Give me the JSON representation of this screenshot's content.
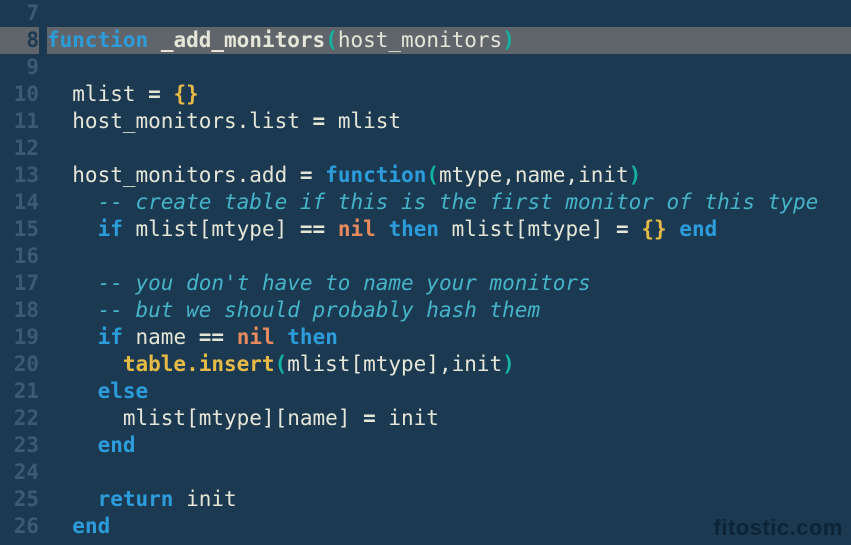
{
  "watermark": "fitostic.com",
  "highlighted_line_index": 1,
  "lines": [
    {
      "num": "7",
      "tokens": []
    },
    {
      "num": "8",
      "tokens": [
        {
          "cls": "tok-kw",
          "t": "function"
        },
        {
          "cls": "tok-id",
          "t": " "
        },
        {
          "cls": "tok-fn",
          "t": "_add_monitors"
        },
        {
          "cls": "tok-par",
          "t": "("
        },
        {
          "cls": "tok-id",
          "t": "host_monitors"
        },
        {
          "cls": "tok-par",
          "t": ")"
        }
      ]
    },
    {
      "num": "9",
      "tokens": []
    },
    {
      "num": "10",
      "tokens": [
        {
          "cls": "tok-id",
          "t": "  mlist "
        },
        {
          "cls": "tok-pun",
          "t": "="
        },
        {
          "cls": "tok-id",
          "t": " "
        },
        {
          "cls": "tok-brc",
          "t": "{}"
        }
      ]
    },
    {
      "num": "11",
      "tokens": [
        {
          "cls": "tok-id",
          "t": "  host_monitors.list "
        },
        {
          "cls": "tok-pun",
          "t": "="
        },
        {
          "cls": "tok-id",
          "t": " mlist"
        }
      ]
    },
    {
      "num": "12",
      "tokens": []
    },
    {
      "num": "13",
      "tokens": [
        {
          "cls": "tok-id",
          "t": "  host_monitors.add "
        },
        {
          "cls": "tok-pun",
          "t": "="
        },
        {
          "cls": "tok-id",
          "t": " "
        },
        {
          "cls": "tok-kw",
          "t": "function"
        },
        {
          "cls": "tok-par",
          "t": "("
        },
        {
          "cls": "tok-id",
          "t": "mtype,name,init"
        },
        {
          "cls": "tok-par",
          "t": ")"
        }
      ]
    },
    {
      "num": "14",
      "tokens": [
        {
          "cls": "tok-id",
          "t": "    "
        },
        {
          "cls": "tok-cmt",
          "t": "-- create table if this is the first monitor of this type"
        }
      ]
    },
    {
      "num": "15",
      "tokens": [
        {
          "cls": "tok-id",
          "t": "    "
        },
        {
          "cls": "tok-kw",
          "t": "if"
        },
        {
          "cls": "tok-id",
          "t": " mlist[mtype] "
        },
        {
          "cls": "tok-pun",
          "t": "=="
        },
        {
          "cls": "tok-id",
          "t": " "
        },
        {
          "cls": "tok-lit",
          "t": "nil"
        },
        {
          "cls": "tok-id",
          "t": " "
        },
        {
          "cls": "tok-kw",
          "t": "then"
        },
        {
          "cls": "tok-id",
          "t": " mlist[mtype] "
        },
        {
          "cls": "tok-pun",
          "t": "="
        },
        {
          "cls": "tok-id",
          "t": " "
        },
        {
          "cls": "tok-brc",
          "t": "{}"
        },
        {
          "cls": "tok-id",
          "t": " "
        },
        {
          "cls": "tok-kw",
          "t": "end"
        }
      ]
    },
    {
      "num": "16",
      "tokens": []
    },
    {
      "num": "17",
      "tokens": [
        {
          "cls": "tok-id",
          "t": "    "
        },
        {
          "cls": "tok-cmt",
          "t": "-- you don't have to name your monitors"
        }
      ]
    },
    {
      "num": "18",
      "tokens": [
        {
          "cls": "tok-id",
          "t": "    "
        },
        {
          "cls": "tok-cmt",
          "t": "-- but we should probably hash them"
        }
      ]
    },
    {
      "num": "19",
      "tokens": [
        {
          "cls": "tok-id",
          "t": "    "
        },
        {
          "cls": "tok-kw",
          "t": "if"
        },
        {
          "cls": "tok-id",
          "t": " name "
        },
        {
          "cls": "tok-pun",
          "t": "=="
        },
        {
          "cls": "tok-id",
          "t": " "
        },
        {
          "cls": "tok-lit",
          "t": "nil"
        },
        {
          "cls": "tok-id",
          "t": " "
        },
        {
          "cls": "tok-kw",
          "t": "then"
        }
      ]
    },
    {
      "num": "20",
      "tokens": [
        {
          "cls": "tok-id",
          "t": "      "
        },
        {
          "cls": "tok-lib",
          "t": "table.insert"
        },
        {
          "cls": "tok-par",
          "t": "("
        },
        {
          "cls": "tok-id",
          "t": "mlist[mtype],init"
        },
        {
          "cls": "tok-par",
          "t": ")"
        }
      ]
    },
    {
      "num": "21",
      "tokens": [
        {
          "cls": "tok-id",
          "t": "    "
        },
        {
          "cls": "tok-kw",
          "t": "else"
        }
      ]
    },
    {
      "num": "22",
      "tokens": [
        {
          "cls": "tok-id",
          "t": "      mlist[mtype][name] "
        },
        {
          "cls": "tok-pun",
          "t": "="
        },
        {
          "cls": "tok-id",
          "t": " init"
        }
      ]
    },
    {
      "num": "23",
      "tokens": [
        {
          "cls": "tok-id",
          "t": "    "
        },
        {
          "cls": "tok-kw",
          "t": "end"
        }
      ]
    },
    {
      "num": "24",
      "tokens": []
    },
    {
      "num": "25",
      "tokens": [
        {
          "cls": "tok-id",
          "t": "    "
        },
        {
          "cls": "tok-kw",
          "t": "return"
        },
        {
          "cls": "tok-id",
          "t": " init"
        }
      ]
    },
    {
      "num": "26",
      "tokens": [
        {
          "cls": "tok-id",
          "t": "  "
        },
        {
          "cls": "tok-kw",
          "t": "end"
        }
      ]
    }
  ]
}
